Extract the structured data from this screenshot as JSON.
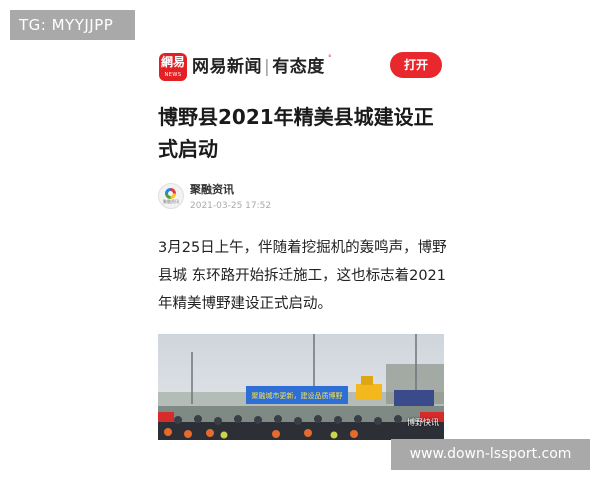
{
  "watermark_top": "TG: MYYJJPP",
  "watermark_bottom": "www.down-lssport.com",
  "app": {
    "logo_top": "網易",
    "logo_bottom": "NEWS",
    "name": "网易新闻",
    "slogan": "有态度",
    "open_label": "打开"
  },
  "article": {
    "title": "博野县2021年精美县城建设正式启动",
    "source_name": "聚融资讯",
    "source_avatar_text": "聚融资讯",
    "time": "2021-03-25 17:52",
    "paragraph": "3月25日上午，伴随着挖掘机的轰鸣声，博野县城 东环路开始拆迁施工，这也标志着2021年精美博野建设正式启动。",
    "image_caption": "博野快讯",
    "banner_text": "聚融城市更新，建设品质博野"
  },
  "colors": {
    "accent": "#e8282c",
    "watermark_bg": "#a9a9a9"
  }
}
